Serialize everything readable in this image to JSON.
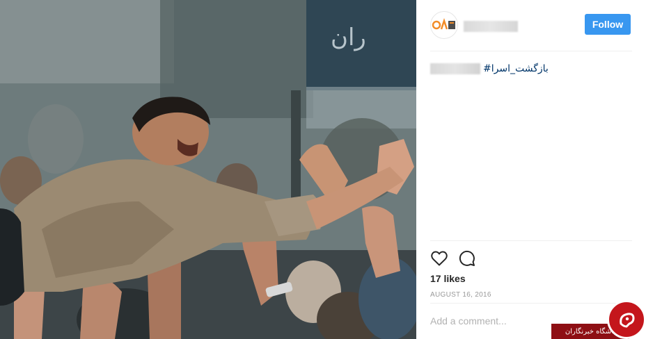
{
  "post": {
    "photo": {
      "description_icon": "photo-crowd"
    },
    "header": {
      "username": "",
      "follow_label": "Follow",
      "avatar_icon": "brand-logo"
    },
    "caption": {
      "hashtag": "#بازگشت_اسرا"
    },
    "actions": {
      "like_icon": "heart-icon",
      "comment_icon": "comment-icon"
    },
    "likes": "17 likes",
    "date": "AUGUST 16, 2016",
    "comment": {
      "placeholder": "Add a comment..."
    }
  },
  "watermark": {
    "label": "باشگاه خبرنگاران",
    "icon": "brand-circle-logo"
  },
  "colors": {
    "follow": "#3897f0",
    "hashtag": "#003569",
    "watermark": "#c4161c"
  }
}
